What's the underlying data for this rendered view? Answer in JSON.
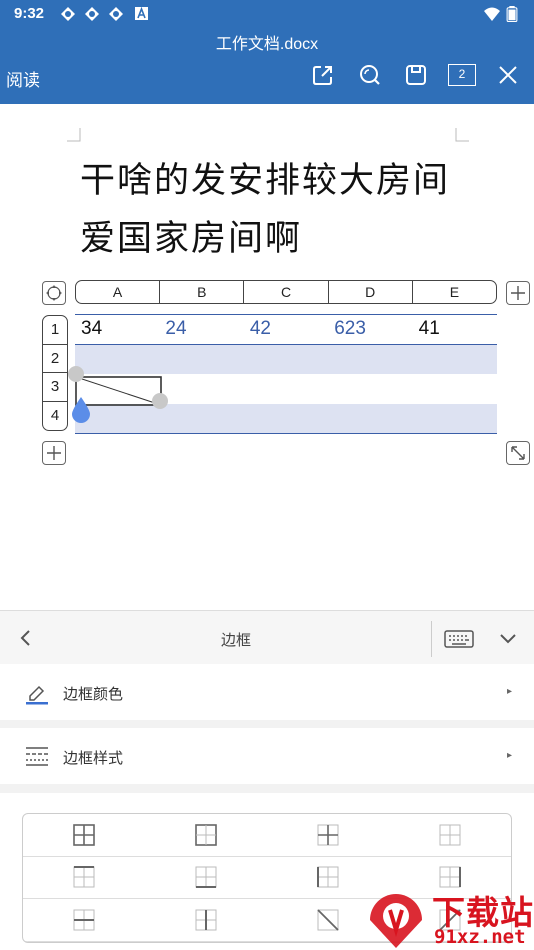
{
  "status_bar": {
    "time": "9:32"
  },
  "header": {
    "title": "工作文档.docx",
    "mode_label": "阅读",
    "page_count": "2",
    "accent_color": "#2f6fb8",
    "icons": [
      "share-icon",
      "search-icon",
      "save-icon",
      "page-count-icon",
      "close-icon"
    ]
  },
  "document": {
    "text": "干啥的发安排较大房间爱国家房间啊",
    "table": {
      "columns": [
        "A",
        "B",
        "C",
        "D",
        "E"
      ],
      "rows": [
        "1",
        "2",
        "3",
        "4"
      ],
      "row1_values": [
        "34",
        "24",
        "42",
        "623",
        "41"
      ],
      "value_colors": [
        "#111111",
        "#3a5ea8",
        "#3a5ea8",
        "#3a5ea8",
        "#111111"
      ],
      "shaded_color": "#dde2f2"
    }
  },
  "panel": {
    "title": "边框",
    "items": [
      {
        "label": "边框颜色",
        "icon": "pen-underline-icon"
      },
      {
        "label": "边框样式",
        "icon": "line-style-icon"
      }
    ]
  },
  "watermark": {
    "text1": "下载站",
    "text2": "91xz.net"
  }
}
